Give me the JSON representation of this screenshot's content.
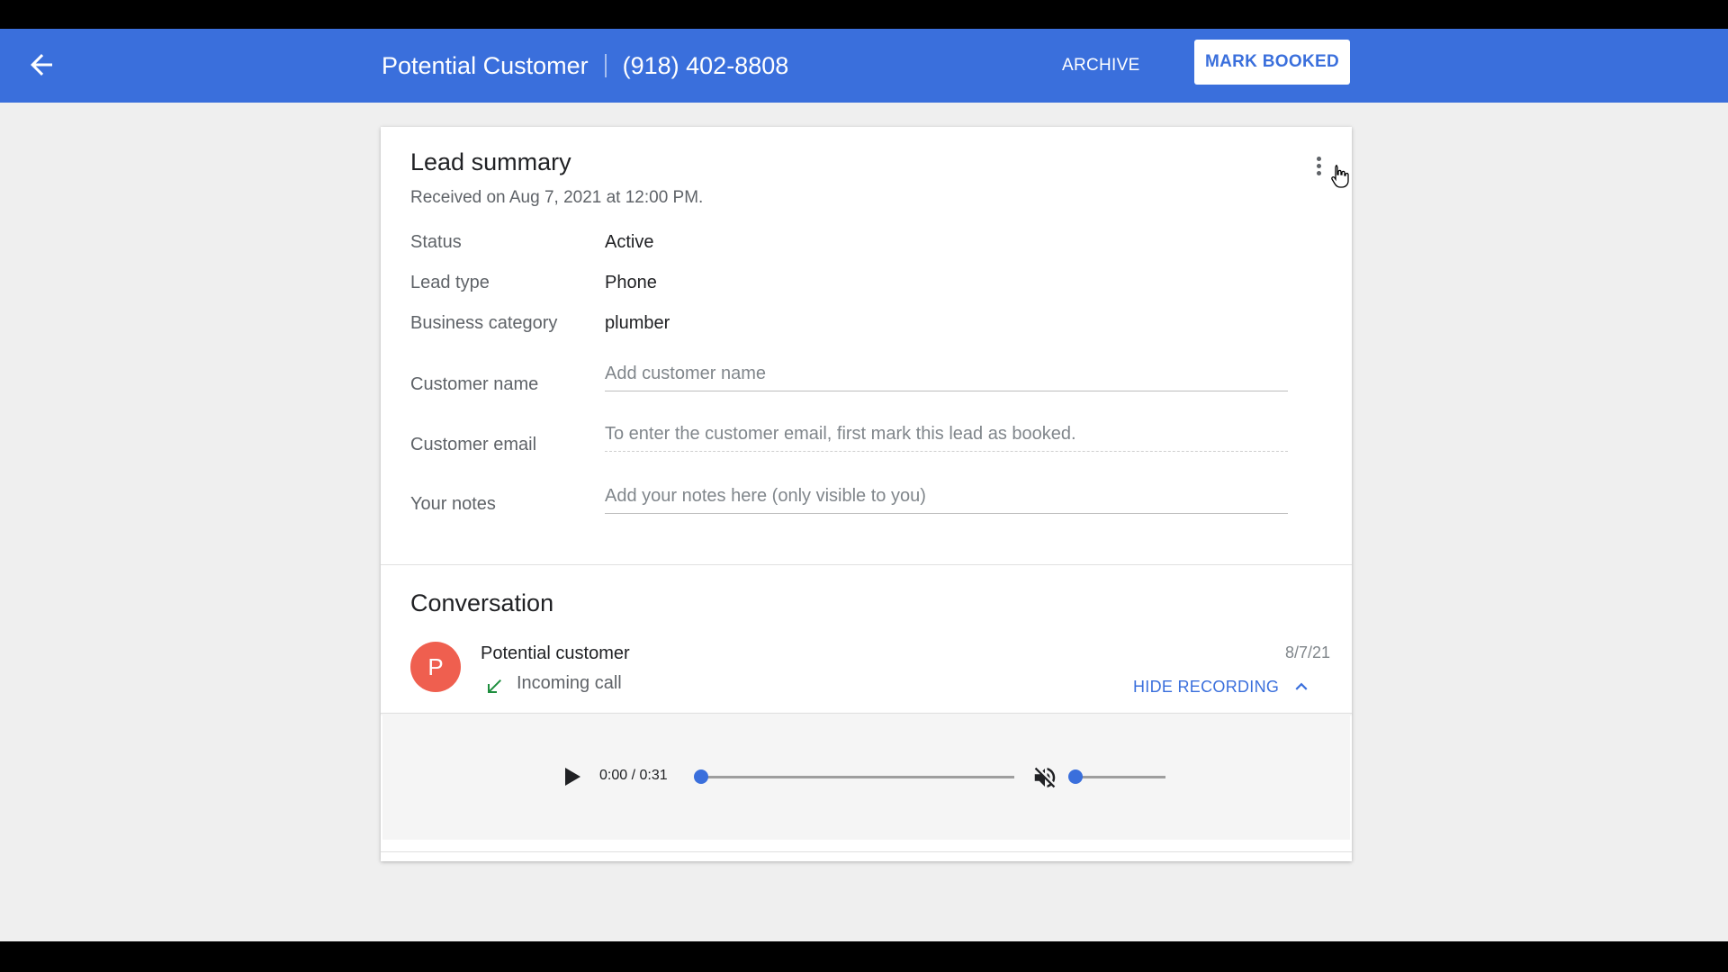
{
  "header": {
    "title": "Potential Customer",
    "phone": "(918) 402-8808",
    "archive_label": "ARCHIVE",
    "mark_booked_label": "MARK BOOKED",
    "back_icon": "arrow-back-icon",
    "brand_color": "#3a6fdc"
  },
  "lead_summary": {
    "heading": "Lead summary",
    "received": "Received on Aug 7, 2021 at 12:00 PM.",
    "more_icon": "more-vert-icon",
    "rows": [
      {
        "label": "Status",
        "value": "Active"
      },
      {
        "label": "Lead type",
        "value": "Phone"
      },
      {
        "label": "Business category",
        "value": "plumber"
      }
    ],
    "fields": [
      {
        "label": "Customer name",
        "value": "",
        "placeholder": "Add customer name"
      },
      {
        "label": "Customer email",
        "value": "",
        "placeholder": "To enter the customer email, first mark this lead as booked."
      },
      {
        "label": "Your notes",
        "value": "",
        "placeholder": "Add your notes here (only visible to you)"
      }
    ]
  },
  "conversation": {
    "heading": "Conversation",
    "avatar_letter": "P",
    "avatar_color": "#ef5f4f",
    "caller": "Potential customer",
    "call_type": "Incoming call",
    "call_type_icon": "call-received-icon",
    "date": "8/7/21",
    "hide_recording_label": "HIDE RECORDING",
    "hide_recording_icon": "chevron-up-icon"
  },
  "player": {
    "time": "0:00 / 0:31",
    "progress": 0,
    "muted": true,
    "volume": 0,
    "play_icon": "play-icon",
    "mute_icon": "volume-off-icon"
  }
}
